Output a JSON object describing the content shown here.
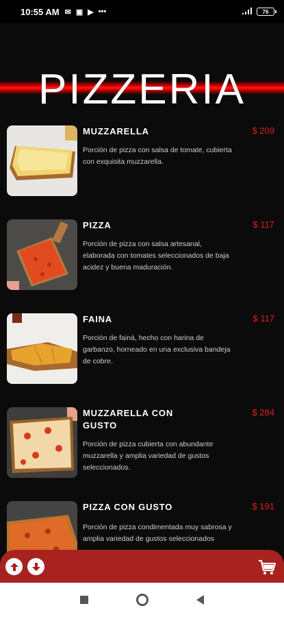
{
  "status_bar": {
    "time": "10:55 AM",
    "battery": "76",
    "icons": [
      "mail-icon",
      "cast-icon",
      "play-icon",
      "more-icon",
      "signal-icon",
      "battery-icon"
    ]
  },
  "header": {
    "title": "PIZZERIA"
  },
  "menu": {
    "items": [
      {
        "name": "MUZZARELLA",
        "price": "$ 209",
        "description": "Porción de pizza con salsa de tomate, cubierta con exquisita muzzarella."
      },
      {
        "name": "PIZZA",
        "price": "$ 117",
        "description": "Porción de pizza con salsa artesanal, elaborada con tomates seleccionados de baja acidez y buena maduración."
      },
      {
        "name": "FAINA",
        "price": "$ 117",
        "description": "Porción de fainá, hecho con harina de garbanzo, horneado en una exclusiva bandeja de cobre."
      },
      {
        "name": "MUZZARELLA CON GUSTO",
        "price": "$ 284",
        "description": "Porción de pizza cubierta con abundante muzzarella y amplia variedad de gustos seleccionados."
      },
      {
        "name": "PIZZA CON GUSTO",
        "price": "$ 191",
        "description": "Porción de pizza condimentada muy sabrosa y amplia variedad de gustos seleccionados"
      }
    ]
  },
  "colors": {
    "accent": "#e41c1c",
    "bottom_bar": "#a8221f",
    "background": "#0b0b0b"
  }
}
